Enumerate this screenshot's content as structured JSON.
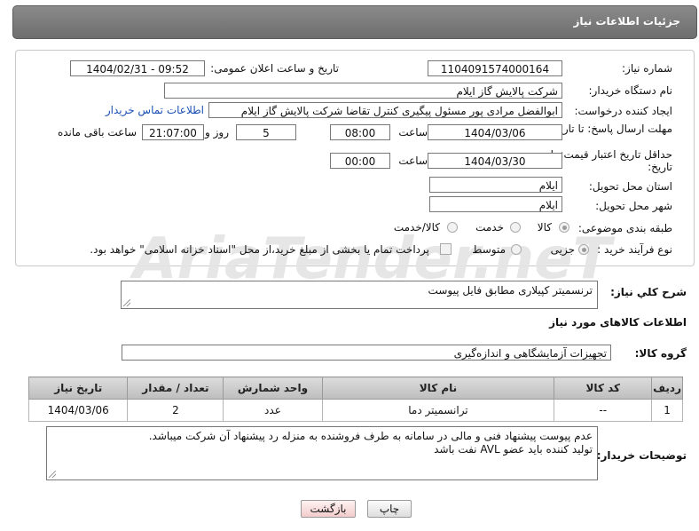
{
  "header": {
    "title": "جزئیات اطلاعات نیاز"
  },
  "watermark": "AriaTender.neT",
  "form": {
    "need_number_label": "شماره نیاز:",
    "need_number": "1104091574000164",
    "announce_label": "تاریخ و ساعت اعلان عمومی:",
    "announce_value": "1404/02/31 - 09:52",
    "buyer_org_label": "نام دستگاه خریدار:",
    "buyer_org": "شرکت پالایش گاز ایلام",
    "requester_label": "ایجاد کننده درخواست:",
    "requester": "ابوالفضل مرادی پور مسئول پیگیری کنترل تقاضا شرکت پالایش گاز ایلام",
    "buyer_contact_link": "اطلاعات تماس خریدار",
    "deadline_label": "مهلت ارسال پاسخ: تا تاریخ:",
    "deadline_date": "1404/03/06",
    "time_label": "ساعت",
    "deadline_time": "08:00",
    "days_value": "5",
    "days_label": "روز و",
    "remaining_time": "21:07:00",
    "remaining_label": "ساعت باقی مانده",
    "min_validity_label": "حداقل تاریخ اعتبار قیمت: تا تاریخ:",
    "validity_date": "1404/03/30",
    "validity_time": "00:00",
    "province_label": "استان محل تحویل:",
    "province": "ایلام",
    "city_label": "شهر محل تحویل:",
    "city": "ایلام",
    "category_label": "طبقه بندی موضوعی:",
    "category_options": [
      "کالا",
      "خدمت",
      "کالا/خدمت"
    ],
    "process_label": "نوع فرآیند خرید :",
    "process_options": [
      "جزیی",
      "متوسط"
    ],
    "payment_note": "پرداخت تمام یا بخشی از مبلغ خرید،از محل \"اسناد خزانه اسلامی\" خواهد بود."
  },
  "summary": {
    "label": "شرح كلي نياز:",
    "text": "ترنسمیتر کپیلاری مطابق فایل پیوست"
  },
  "goods_section": {
    "title": "اطلاعات کالاهای مورد نیاز",
    "group_label": "گروه کالا:",
    "group_value": "تجهیزات آزمایشگاهی و اندازه‌گیری"
  },
  "table": {
    "headers": [
      "ردیف",
      "کد کالا",
      "نام کالا",
      "واحد شمارش",
      "تعداد / مقدار",
      "تاریخ نیاز"
    ],
    "rows": [
      [
        "1",
        "--",
        "ترانسمیتر دما",
        "عدد",
        "2",
        "1404/03/06"
      ]
    ]
  },
  "buyer_notes": {
    "label": "توضیحات خریدار:",
    "line1": "عدم پیوست پیشنهاد فنی و مالی در سامانه به طرف فروشنده به منزله رد پیشنهاد آن شرکت میباشد.",
    "line2": "تولید کننده باید عضو AVL نفت باشد"
  },
  "buttons": {
    "print": "چاپ",
    "back": "بازگشت"
  }
}
